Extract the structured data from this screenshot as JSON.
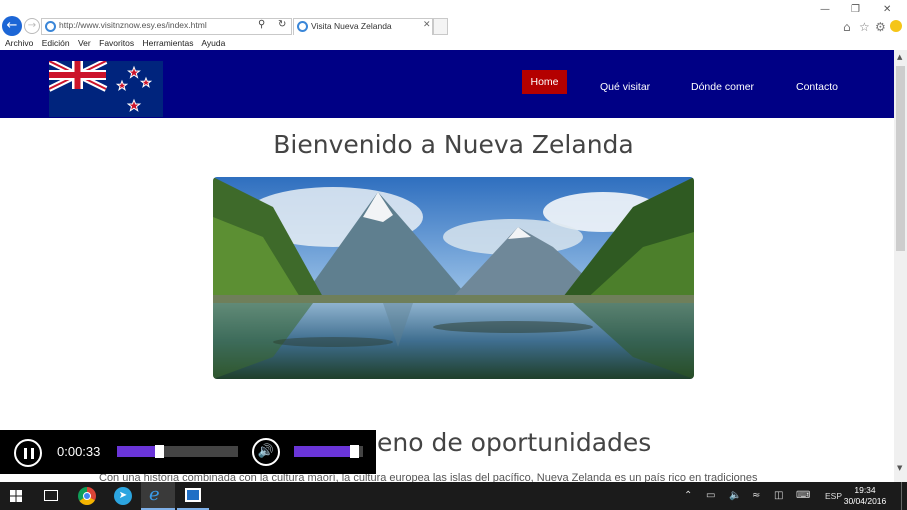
{
  "browser": {
    "url": "http://www.visitnznow.esy.es/index.html",
    "tab_title": "Visita Nueva Zelanda",
    "menu": [
      "Archivo",
      "Edición",
      "Ver",
      "Favoritos",
      "Herramientas",
      "Ayuda"
    ],
    "window_controls": [
      "—",
      "❐",
      "✕"
    ]
  },
  "site": {
    "nav": {
      "home": "Home",
      "items": [
        "Qué visitar",
        "Dónde comer",
        "Contacto"
      ]
    },
    "title": "Bienvenido a Nueva Zelanda",
    "section_heading": "eno de oportunidades",
    "paragraph": "Con una historia combinada con la cultura maorí, la cultura europea las islas del pacífico, Nueva Zelanda es un país rico en tradiciones"
  },
  "media_player": {
    "time": "0:00:33",
    "progress": 0.31,
    "volume": 0.9
  },
  "taskbar": {
    "language": "ESP",
    "time": "19:34",
    "date": "30/04/2016"
  },
  "colors": {
    "nav_bg": "#000085",
    "nav_active": "#b40000",
    "media_accent": "#6a35d8",
    "ie_blue": "#1c66d6"
  }
}
